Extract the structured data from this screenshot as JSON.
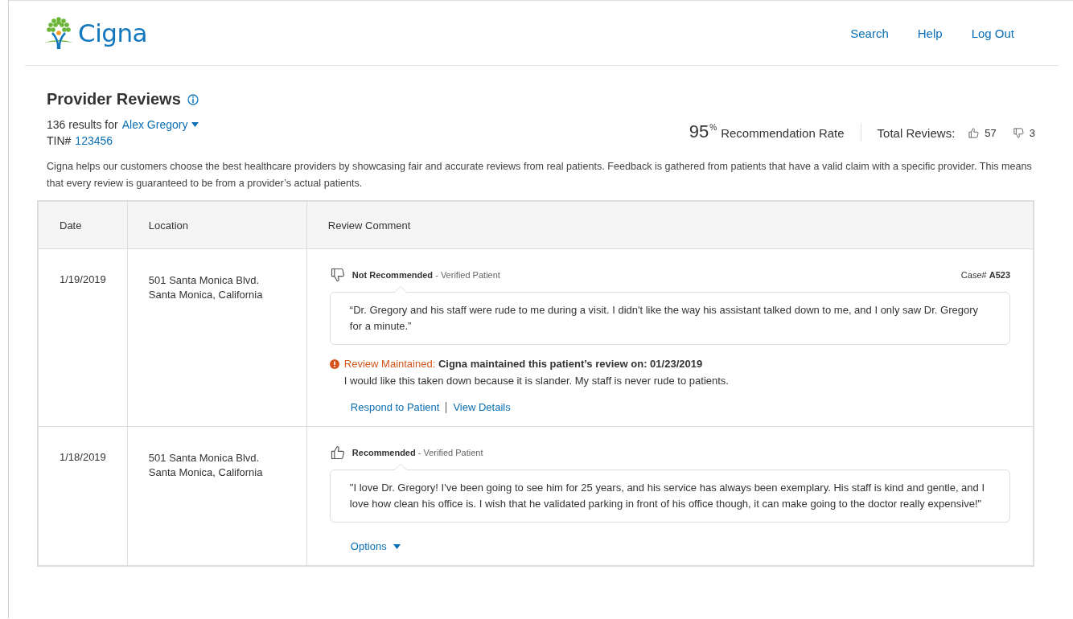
{
  "logo": {
    "text": "Cigna"
  },
  "nav": [
    "Search",
    "Help",
    "Log Out"
  ],
  "header": {
    "title": "Provider Reviews",
    "results_prefix": "136 results for",
    "provider": "Alex Gregory",
    "tin_label": "TIN#",
    "tin": "123456",
    "rate": "95",
    "rate_unit": "%",
    "rate_label": "Recommendation Rate",
    "total_label": "Total Reviews:",
    "up_count": "57",
    "down_count": "3"
  },
  "description": "Cigna helps our customers choose the best healthcare providers by showcasing fair and accurate reviews from real patients. Feedback is gathered from patients that have a valid claim with a specific provider. This means that every review is guaranteed to be from a provider’s actual patients.",
  "table": {
    "columns": [
      "Date",
      "Location",
      "Review Comment"
    ],
    "rows": [
      {
        "date": "1/19/2019",
        "location": [
          "501 Santa Monica Blvd.",
          "Santa Monica, California"
        ],
        "kind": "not_recommended",
        "verdict": "Not Recommended",
        "source": "- Verified Patient",
        "case_label": "Case#",
        "case": "A523",
        "comment": "“Dr. Gregory and his staff were rude to me during a visit. I didn't like the way his assistant talked down to me, and I only saw Dr. Gregory for a minute.”",
        "status": {
          "label": "Review Maintained:",
          "text": "Cigna maintained this patient’s review on: 01/23/2019",
          "response": "I would like this taken down because it is slander. My staff is never rude to patients."
        },
        "actions": [
          "Respond to Patient",
          "View Details"
        ]
      },
      {
        "date": "1/18/2019",
        "location": [
          "501 Santa Monica Blvd.",
          "Santa Monica, California"
        ],
        "kind": "recommended",
        "verdict": "Recommended",
        "source": "- Verified Patient",
        "comment": "\"I love Dr. Gregory! I've been going to see him for 25 years, and his service has always been exemplary. His staff is kind and gentle, and I love how clean his office is. I wish that he validated parking in front of his office though, it can make going to the doctor really expensive!\"",
        "options": "Options"
      }
    ]
  }
}
